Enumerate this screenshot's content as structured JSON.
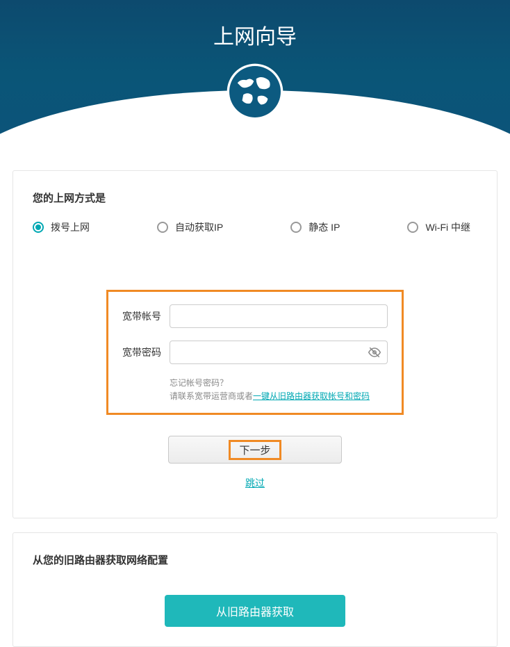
{
  "header": {
    "title": "上网向导"
  },
  "card1": {
    "title": "您的上网方式是",
    "options": [
      {
        "label": "拨号上网",
        "selected": true
      },
      {
        "label": "自动获取IP",
        "selected": false
      },
      {
        "label": "静态 IP",
        "selected": false
      },
      {
        "label": "Wi-Fi 中继",
        "selected": false
      }
    ],
    "form": {
      "account_label": "宽带帐号",
      "password_label": "宽带密码",
      "account_value": "",
      "password_value": "",
      "hint_line1": "忘记帐号密码？",
      "hint_line2_prefix": "请联系宽带运营商或者",
      "hint_link": "一键从旧路由器获取帐号和密码"
    },
    "next_button": "下一步",
    "skip_link": "跳过"
  },
  "card2": {
    "title": "从您的旧路由器获取网络配置",
    "button": "从旧路由器获取"
  }
}
